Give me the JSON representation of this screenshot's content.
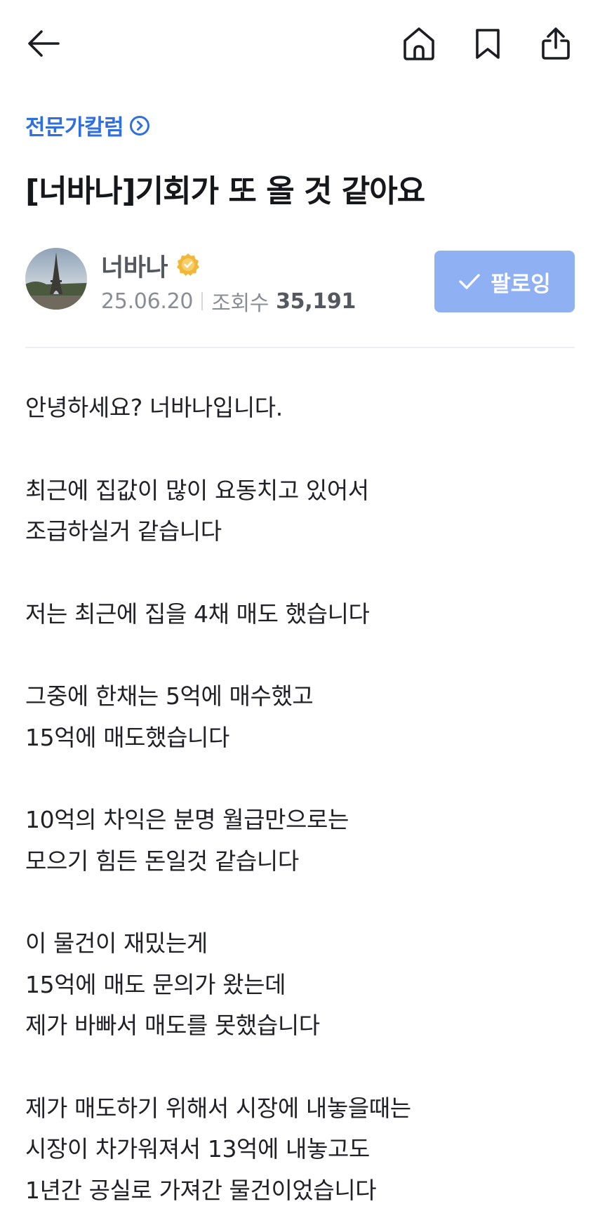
{
  "topbar": {
    "back_icon": "arrow-left-icon",
    "home_icon": "home-icon",
    "bookmark_icon": "bookmark-icon",
    "share_icon": "share-icon"
  },
  "article": {
    "category": "전문가칼럼",
    "category_icon": "chevron-circle-right-icon",
    "title": "[너바나]기회가 또 올 것 같아요",
    "author": {
      "name": "너바나",
      "badge_icon": "verified-badge-icon",
      "date": "25.06.20",
      "views_label": "조회수",
      "views_value": "35,191",
      "follow_label": "팔로잉"
    },
    "body": [
      "안녕하세요? 너바나입니다.",
      "",
      "최근에 집값이 많이 요동치고 있어서",
      "조급하실거 같습니다",
      "",
      "저는 최근에 집을 4채 매도 했습니다",
      "",
      "그중에 한채는 5억에 매수했고",
      "15억에 매도했습니다",
      "",
      "10억의 차익은 분명 월급만으로는",
      "모으기 힘든 돈일것 같습니다",
      "",
      "이 물건이 재밌는게",
      "15억에 매도 문의가 왔는데",
      "제가 바빠서 매도를 못했습니다",
      "",
      "제가 매도하기 위해서 시장에 내놓을때는",
      "시장이 차가워져서 13억에 내놓고도",
      "1년간 공실로 가져간 물건이었습니다"
    ]
  },
  "colors": {
    "accent": "#2f6fde",
    "follow_bg": "#8fb1f3",
    "badge": "#f2b73a"
  }
}
